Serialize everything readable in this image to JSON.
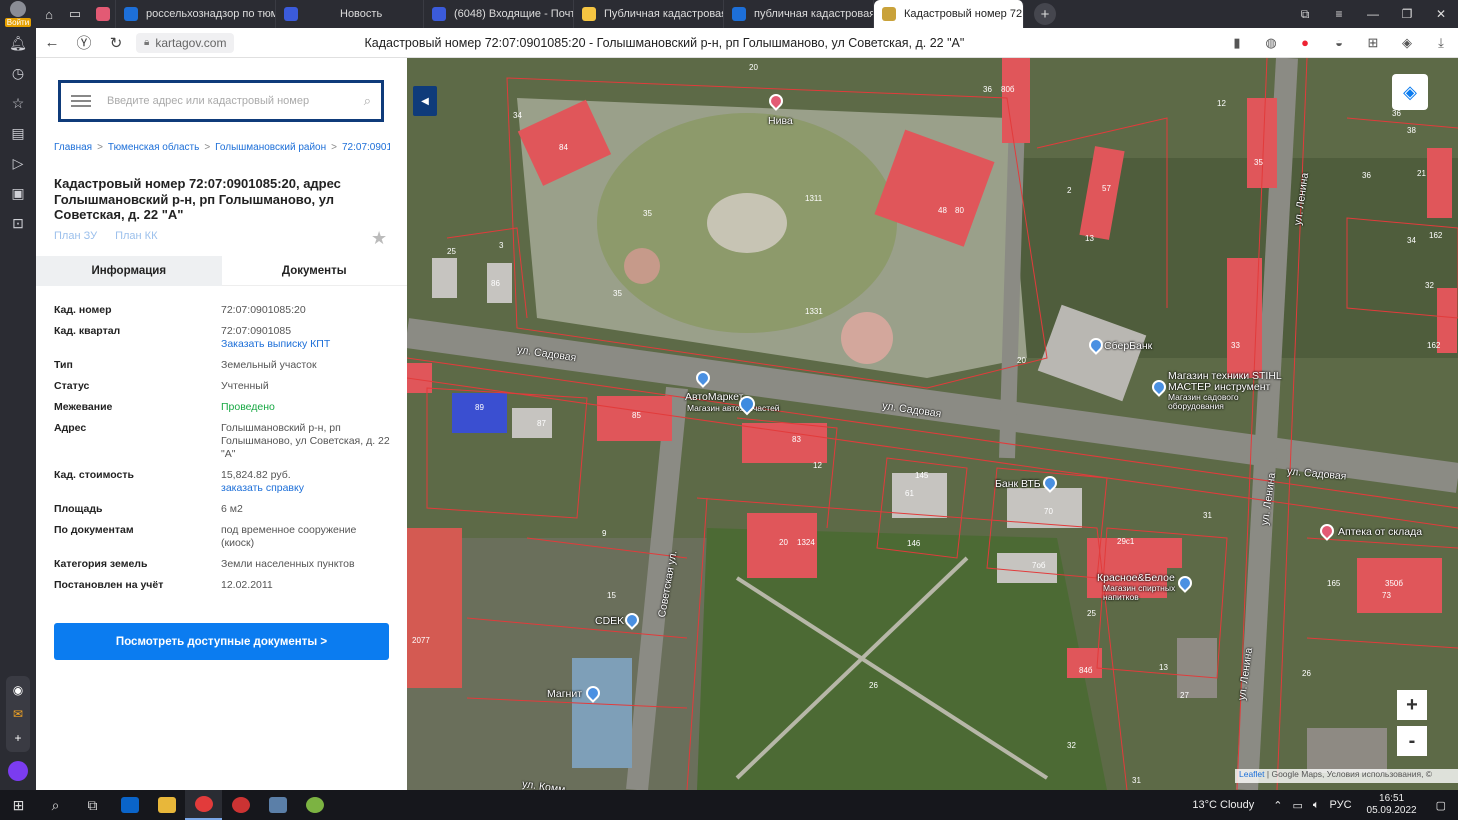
{
  "browser": {
    "profile_label": "Войти",
    "tabs": [
      {
        "title": "россельхознадзор по тюм",
        "color": "#1d6fd8"
      },
      {
        "title": "Новость",
        "color": "#3b5bdb"
      },
      {
        "title": "(6048) Входящие - Почта",
        "color": "#3b5bdb"
      },
      {
        "title": "Публичная кадастровая к",
        "color": "#f5c542"
      },
      {
        "title": "публичная кадастровая к",
        "color": "#1d6fd8"
      },
      {
        "title": "Кадастровый номер 72",
        "color": "#c9a23a"
      }
    ],
    "url": "kartagov.com",
    "page_title": "Кадастровый номер 72:07:0901085:20 - Голышмановский р-н, рп Голышманово, ул Советская, д. 22 \"А\""
  },
  "search": {
    "placeholder": "Введите адрес или кадастровый номер"
  },
  "breadcrumbs": [
    "Главная",
    "Тюменская область",
    "Голышмановский район",
    "72:07:0901085:20"
  ],
  "title": "Кадастровый номер 72:07:0901085:20, адрес Голышмановский р-н, рп Голышманово, ул Советская, д. 22 \"А\"",
  "plan_links": [
    "План ЗУ",
    "План КК"
  ],
  "tabs": [
    "Информация",
    "Документы"
  ],
  "props": {
    "cad_num": {
      "k": "Кад. номер",
      "v": "72:07:0901085:20"
    },
    "quarter": {
      "k": "Кад. квартал",
      "v": "72:07:0901085",
      "link": "Заказать выписку КПТ"
    },
    "type": {
      "k": "Тип",
      "v": "Земельный участок"
    },
    "status": {
      "k": "Статус",
      "v": "Учтенный"
    },
    "survey": {
      "k": "Межевание",
      "v": "Проведено"
    },
    "address": {
      "k": "Адрес",
      "v": "Голышмановский р-н, рп Голышманово, ул Советская, д. 22 \"А\""
    },
    "cost": {
      "k": "Кад. стоимость",
      "v": "15,824.82 руб.",
      "link": "заказать справку"
    },
    "area": {
      "k": "Площадь",
      "v": "6 м2"
    },
    "by_docs": {
      "k": "По документам",
      "v": "под временное сооружение (киоск)"
    },
    "category": {
      "k": "Категория земель",
      "v": "Земли населенных пунктов"
    },
    "registered": {
      "k": "Постановлен на учёт",
      "v": "12.02.2011"
    }
  },
  "docs_button": "Посмотреть доступные документы >",
  "map": {
    "labels": {
      "niva": "Нива",
      "sberbank": "СберБанк",
      "stihl": "Магазин техники STIHL МАСТЕР инструмент",
      "garden": "Магазин садового оборудования",
      "avtomarket": "АвтоМаркет",
      "autoparts": "Магазин автозапчастей",
      "vtb": "Банк ВТБ",
      "apteka": "Аптека от склада",
      "krasnoe": "Красное&Белое",
      "drinks": "Магазин спиртных напитков",
      "cdek": "CDEK",
      "magnit": "Магнит",
      "sadovaya1": "ул. Садовая",
      "sadovaya2": "ул. Садовая",
      "sadovaya3": "ул. Садовая",
      "sovetskaya": "Советская ул.",
      "lenina1": "ул. Ленина",
      "lenina2": "ул. Ленина",
      "lenina3": "ул. Ленина",
      "komm": "ул. Комм"
    },
    "attribution_leaflet": "Leaflet",
    "attribution_rest": " | Google Maps, Условия использования, ©",
    "zoom_in": "+",
    "zoom_out": "-"
  },
  "taskbar": {
    "weather": "13°C  Cloudy",
    "lang": "РУС",
    "time": "16:51",
    "date": "05.09.2022"
  }
}
